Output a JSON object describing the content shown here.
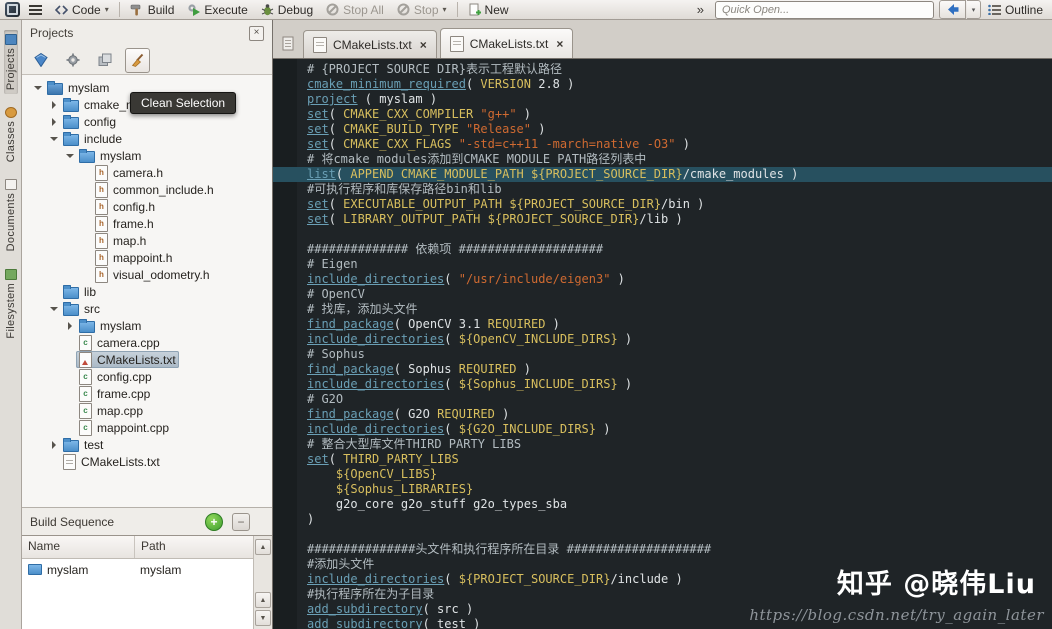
{
  "toolbar": {
    "code": "Code",
    "build": "Build",
    "execute": "Execute",
    "debug": "Debug",
    "stop_all": "Stop All",
    "stop": "Stop",
    "new": "New",
    "overflow": "»",
    "quick_open_placeholder": "Quick Open...",
    "outline": "Outline"
  },
  "side_tabs": [
    {
      "label": "Projects",
      "active": true
    },
    {
      "label": "Classes",
      "active": false
    },
    {
      "label": "Documents",
      "active": false
    },
    {
      "label": "Filesystem",
      "active": false
    }
  ],
  "projects_panel": {
    "title": "Projects",
    "tooltip": "Clean Selection",
    "tree": [
      {
        "l": "myslam",
        "d": 0,
        "i": "project",
        "e": "open"
      },
      {
        "l": "cmake_modules",
        "d": 1,
        "i": "folder",
        "e": "closed"
      },
      {
        "l": "config",
        "d": 1,
        "i": "folder",
        "e": "closed"
      },
      {
        "l": "include",
        "d": 1,
        "i": "folder",
        "e": "open"
      },
      {
        "l": "myslam",
        "d": 2,
        "i": "folder",
        "e": "open"
      },
      {
        "l": "camera.h",
        "d": 3,
        "i": "h"
      },
      {
        "l": "common_include.h",
        "d": 3,
        "i": "h"
      },
      {
        "l": "config.h",
        "d": 3,
        "i": "h"
      },
      {
        "l": "frame.h",
        "d": 3,
        "i": "h"
      },
      {
        "l": "map.h",
        "d": 3,
        "i": "h"
      },
      {
        "l": "mappoint.h",
        "d": 3,
        "i": "h"
      },
      {
        "l": "visual_odometry.h",
        "d": 3,
        "i": "h"
      },
      {
        "l": "lib",
        "d": 1,
        "i": "folder"
      },
      {
        "l": "src",
        "d": 1,
        "i": "folder",
        "e": "open"
      },
      {
        "l": "myslam",
        "d": 2,
        "i": "folder",
        "e": "closed"
      },
      {
        "l": "camera.cpp",
        "d": 2,
        "i": "cpp"
      },
      {
        "l": "CMakeLists.txt",
        "d": 2,
        "i": "cmake",
        "sel": true
      },
      {
        "l": "config.cpp",
        "d": 2,
        "i": "cpp"
      },
      {
        "l": "frame.cpp",
        "d": 2,
        "i": "cpp"
      },
      {
        "l": "map.cpp",
        "d": 2,
        "i": "cpp"
      },
      {
        "l": "mappoint.cpp",
        "d": 2,
        "i": "cpp"
      },
      {
        "l": "test",
        "d": 1,
        "i": "folder",
        "e": "closed"
      },
      {
        "l": "CMakeLists.txt",
        "d": 1,
        "i": "txt"
      }
    ]
  },
  "build_sequence": {
    "title": "Build Sequence",
    "columns": [
      "Name",
      "Path"
    ],
    "rows": [
      {
        "name": "myslam",
        "path": "myslam"
      }
    ]
  },
  "editor": {
    "tabs": [
      {
        "label": "CMakeLists.txt"
      },
      {
        "label": "CMakeLists.txt"
      }
    ],
    "active_tab": 1,
    "highlight_line": 8,
    "lines": [
      [
        [
          "c",
          "# {PROJECT SOURCE DIR}表示工程默认路径"
        ]
      ],
      [
        [
          "m",
          "cmake_minimum_required"
        ],
        [
          "p",
          "( "
        ],
        [
          "k",
          "VERSION"
        ],
        [
          "p",
          " "
        ],
        [
          "n",
          "2.8"
        ],
        [
          "p",
          " )"
        ]
      ],
      [
        [
          "m",
          "project"
        ],
        [
          "p",
          " ( myslam )"
        ]
      ],
      [
        [
          "m",
          "set"
        ],
        [
          "p",
          "( "
        ],
        [
          "k",
          "CMAKE_CXX_COMPILER"
        ],
        [
          "p",
          " "
        ],
        [
          "s",
          "\"g++\""
        ],
        [
          "p",
          " )"
        ]
      ],
      [
        [
          "m",
          "set"
        ],
        [
          "p",
          "( "
        ],
        [
          "k",
          "CMAKE_BUILD_TYPE"
        ],
        [
          "p",
          " "
        ],
        [
          "s",
          "\"Release\""
        ],
        [
          "p",
          " )"
        ]
      ],
      [
        [
          "m",
          "set"
        ],
        [
          "p",
          "( "
        ],
        [
          "k",
          "CMAKE_CXX_FLAGS"
        ],
        [
          "p",
          " "
        ],
        [
          "s",
          "\"-std=c++11 -march=native -O3\""
        ],
        [
          "p",
          " )"
        ]
      ],
      [
        [
          "c",
          "# 将cmake modules添加到CMAKE MODULE PATH路径列表中"
        ]
      ],
      [
        [
          "m",
          "list"
        ],
        [
          "p",
          "( "
        ],
        [
          "k",
          "APPEND CMAKE_MODULE_PATH"
        ],
        [
          "p",
          " "
        ],
        [
          "v",
          "${PROJECT_SOURCE_DIR}"
        ],
        [
          "p",
          "/cmake_modules )"
        ]
      ],
      [
        [
          "c",
          "#可执行程序和库保存路径bin和lib"
        ]
      ],
      [
        [
          "m",
          "set"
        ],
        [
          "p",
          "( "
        ],
        [
          "k",
          "EXECUTABLE_OUTPUT_PATH"
        ],
        [
          "p",
          " "
        ],
        [
          "v",
          "${PROJECT_SOURCE_DIR}"
        ],
        [
          "p",
          "/bin )"
        ]
      ],
      [
        [
          "m",
          "set"
        ],
        [
          "p",
          "( "
        ],
        [
          "k",
          "LIBRARY_OUTPUT_PATH"
        ],
        [
          "p",
          " "
        ],
        [
          "v",
          "${PROJECT_SOURCE_DIR}"
        ],
        [
          "p",
          "/lib )"
        ]
      ],
      [],
      [
        [
          "c",
          "############## 依赖项 ####################"
        ]
      ],
      [
        [
          "c",
          "# Eigen"
        ]
      ],
      [
        [
          "m",
          "include_directories"
        ],
        [
          "p",
          "( "
        ],
        [
          "s",
          "\"/usr/include/eigen3\""
        ],
        [
          "p",
          " )"
        ]
      ],
      [
        [
          "c",
          "# OpenCV"
        ]
      ],
      [
        [
          "c",
          "# 找库，添加头文件"
        ]
      ],
      [
        [
          "m",
          "find_package"
        ],
        [
          "p",
          "( OpenCV "
        ],
        [
          "n",
          "3.1"
        ],
        [
          "p",
          " "
        ],
        [
          "k",
          "REQUIRED"
        ],
        [
          "p",
          " )"
        ]
      ],
      [
        [
          "m",
          "include_directories"
        ],
        [
          "p",
          "( "
        ],
        [
          "v",
          "${OpenCV_INCLUDE_DIRS}"
        ],
        [
          "p",
          " )"
        ]
      ],
      [
        [
          "c",
          "# Sophus"
        ]
      ],
      [
        [
          "m",
          "find_package"
        ],
        [
          "p",
          "( Sophus "
        ],
        [
          "k",
          "REQUIRED"
        ],
        [
          "p",
          " )"
        ]
      ],
      [
        [
          "m",
          "include_directories"
        ],
        [
          "p",
          "( "
        ],
        [
          "v",
          "${Sophus_INCLUDE_DIRS}"
        ],
        [
          "p",
          " )"
        ]
      ],
      [
        [
          "c",
          "# G2O"
        ]
      ],
      [
        [
          "m",
          "find_package"
        ],
        [
          "p",
          "( G2O "
        ],
        [
          "k",
          "REQUIRED"
        ],
        [
          "p",
          " )"
        ]
      ],
      [
        [
          "m",
          "include_directories"
        ],
        [
          "p",
          "( "
        ],
        [
          "v",
          "${G2O_INCLUDE_DIRS}"
        ],
        [
          "p",
          " )"
        ]
      ],
      [
        [
          "c",
          "# 整合大型库文件THIRD PARTY LIBS"
        ]
      ],
      [
        [
          "m",
          "set"
        ],
        [
          "p",
          "( "
        ],
        [
          "k",
          "THIRD_PARTY_LIBS"
        ]
      ],
      [
        [
          "p",
          "    "
        ],
        [
          "v",
          "${OpenCV_LIBS}"
        ]
      ],
      [
        [
          "p",
          "    "
        ],
        [
          "v",
          "${Sophus_LIBRARIES}"
        ]
      ],
      [
        [
          "p",
          "    g2o_core g2o_stuff g2o_types_sba"
        ]
      ],
      [
        [
          "p",
          ")"
        ]
      ],
      [],
      [
        [
          "c",
          "###############头文件和执行程序所在目录 ####################"
        ]
      ],
      [
        [
          "c",
          "#添加头文件"
        ]
      ],
      [
        [
          "m",
          "include_directories"
        ],
        [
          "p",
          "( "
        ],
        [
          "v",
          "${PROJECT_SOURCE_DIR}"
        ],
        [
          "p",
          "/include )"
        ]
      ],
      [
        [
          "c",
          "#执行程序所在为子目录"
        ]
      ],
      [
        [
          "m",
          "add_subdirectory"
        ],
        [
          "p",
          "( src )"
        ]
      ],
      [
        [
          "m",
          "add_subdirectory"
        ],
        [
          "p",
          "( test )"
        ]
      ]
    ]
  },
  "watermark": {
    "zhihu": "知乎 @晓伟Liu",
    "url": "https://blog.csdn.net/try_again_later"
  },
  "colors": {
    "editor_background": "#1f2427",
    "current_line": "#27505f",
    "command": "#6a9fb5",
    "keyword": "#d8bf5e",
    "string": "#cf6a31",
    "comment": "#b3bcc1",
    "selection": "#aebccа"
  }
}
